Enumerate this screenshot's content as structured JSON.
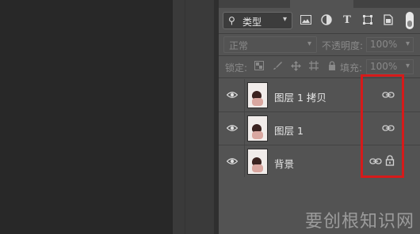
{
  "filter": {
    "label": "类型",
    "icon": "search-icon"
  },
  "filter_icons": [
    "image-filter-icon",
    "adjustment-filter-icon",
    "type-filter-icon",
    "shape-filter-icon",
    "smart-object-filter-icon"
  ],
  "filter_glyphs": {
    "type": "T"
  },
  "blend": {
    "mode": "正常",
    "opacity_label": "不透明度:",
    "opacity_value": "100%"
  },
  "lock": {
    "label": "锁定:",
    "fill_label": "填充:",
    "fill_value": "100%"
  },
  "layers": [
    {
      "name": "图层 1 拷贝",
      "visible": true,
      "linked": true,
      "locked": false
    },
    {
      "name": "图层 1",
      "visible": true,
      "linked": true,
      "locked": false
    },
    {
      "name": "背景",
      "visible": true,
      "linked": true,
      "locked": true
    }
  ],
  "watermark": "要创根知识网",
  "colors": {
    "panel": "#535353",
    "canvas": "#282828",
    "highlight": "#d61a1a"
  }
}
